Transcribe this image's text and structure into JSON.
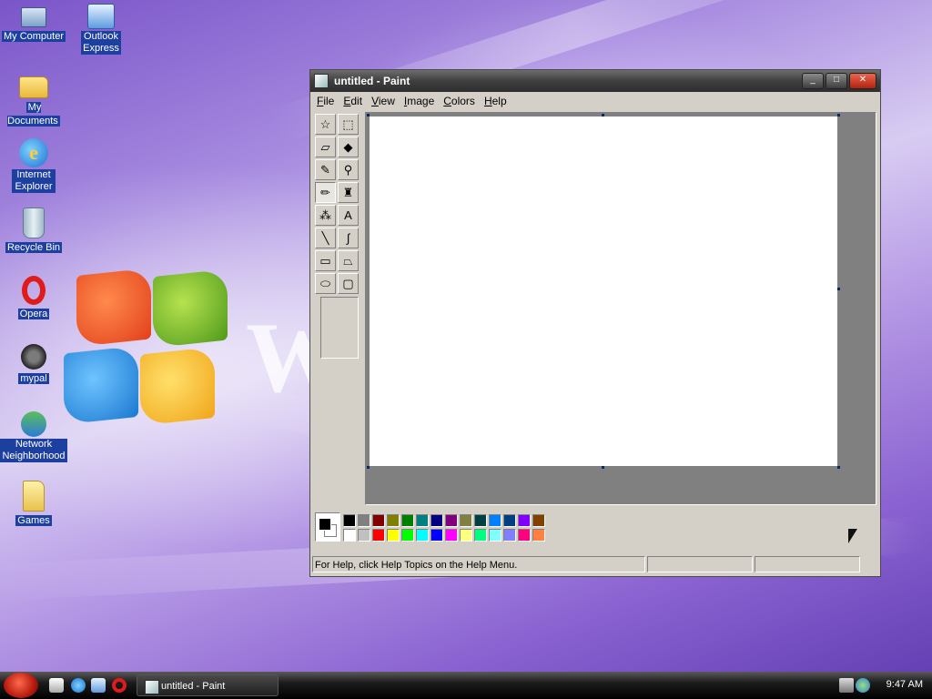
{
  "desktop": {
    "icons": [
      {
        "label": "My Computer",
        "icon": "computer-icon"
      },
      {
        "label": "Outlook Express",
        "icon": "outlook-express-icon"
      },
      {
        "label": "My Documents",
        "icon": "documents-folder-icon"
      },
      {
        "label": "Internet Explorer",
        "icon": "internet-explorer-icon"
      },
      {
        "label": "Recycle Bin",
        "icon": "recycle-bin-icon"
      },
      {
        "label": "Opera",
        "icon": "opera-icon"
      },
      {
        "label": "mypal",
        "icon": "mypal-icon"
      },
      {
        "label": "Network Neighborhood",
        "icon": "network-icon"
      },
      {
        "label": "Games",
        "icon": "games-folder-icon"
      }
    ],
    "wallpaper_letter": "W"
  },
  "window": {
    "title": "untitled - Paint",
    "controls": {
      "minimize": "_",
      "maximize": "□",
      "close": "✕"
    }
  },
  "menubar": [
    "File",
    "Edit",
    "View",
    "Image",
    "Colors",
    "Help"
  ],
  "tools": [
    {
      "name": "free-form-select",
      "glyph": "☆"
    },
    {
      "name": "select",
      "glyph": "⬚"
    },
    {
      "name": "eraser",
      "glyph": "▱"
    },
    {
      "name": "fill-with-color",
      "glyph": "◆"
    },
    {
      "name": "pick-color",
      "glyph": "✎"
    },
    {
      "name": "magnifier",
      "glyph": "⚲"
    },
    {
      "name": "pencil",
      "glyph": "✏"
    },
    {
      "name": "brush",
      "glyph": "♜"
    },
    {
      "name": "airbrush",
      "glyph": "⁂"
    },
    {
      "name": "text",
      "glyph": "A"
    },
    {
      "name": "line",
      "glyph": "╲"
    },
    {
      "name": "curve",
      "glyph": "∫"
    },
    {
      "name": "rectangle",
      "glyph": "▭"
    },
    {
      "name": "polygon",
      "glyph": "⏢"
    },
    {
      "name": "ellipse",
      "glyph": "⬭"
    },
    {
      "name": "rounded-rectangle",
      "glyph": "▢"
    }
  ],
  "selected_tool": "pencil",
  "palette": {
    "foreground": "#000000",
    "background": "#ffffff",
    "top_row": [
      "#000000",
      "#808080",
      "#800000",
      "#808000",
      "#008000",
      "#008080",
      "#000080",
      "#800080",
      "#808040",
      "#004040",
      "#0080ff",
      "#004080",
      "#8000ff",
      "#804000"
    ],
    "bottom_row": [
      "#ffffff",
      "#c0c0c0",
      "#ff0000",
      "#ffff00",
      "#00ff00",
      "#00ffff",
      "#0000ff",
      "#ff00ff",
      "#ffff80",
      "#00ff80",
      "#80ffff",
      "#8080ff",
      "#ff0080",
      "#ff8040"
    ]
  },
  "status": {
    "help_text": "For Help, click Help Topics on the Help Menu.",
    "coords": "",
    "size": ""
  },
  "taskbar": {
    "task_label": "untitled - Paint",
    "clock": "9:47 AM"
  }
}
